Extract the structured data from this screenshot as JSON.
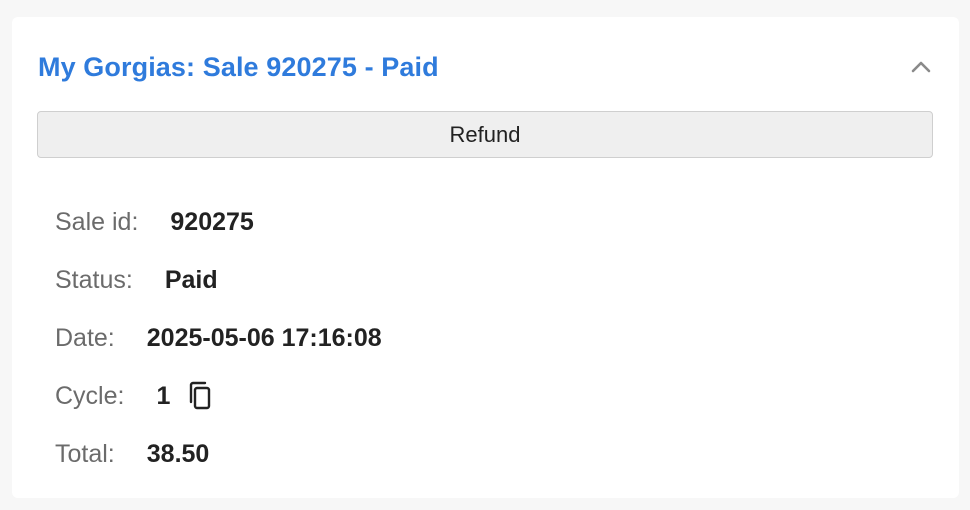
{
  "card": {
    "title": "My Gorgias: Sale 920275 - Paid",
    "collapse_icon": "chevron-up-icon",
    "refund_label": "Refund"
  },
  "details": {
    "sale_id": {
      "label": "Sale id:",
      "value": "920275"
    },
    "status": {
      "label": "Status:",
      "value": "Paid"
    },
    "date": {
      "label": "Date:",
      "value": "2025-05-06 17:16:08"
    },
    "cycle": {
      "label": "Cycle:",
      "value": "1",
      "copy_icon": "copy-icon"
    },
    "total": {
      "label": "Total:",
      "value": "38.50"
    }
  },
  "colors": {
    "accent": "#2f7bdc",
    "label": "#6b6b6b",
    "value": "#222222",
    "button_bg": "#efefef",
    "background": "#f7f7f7"
  }
}
